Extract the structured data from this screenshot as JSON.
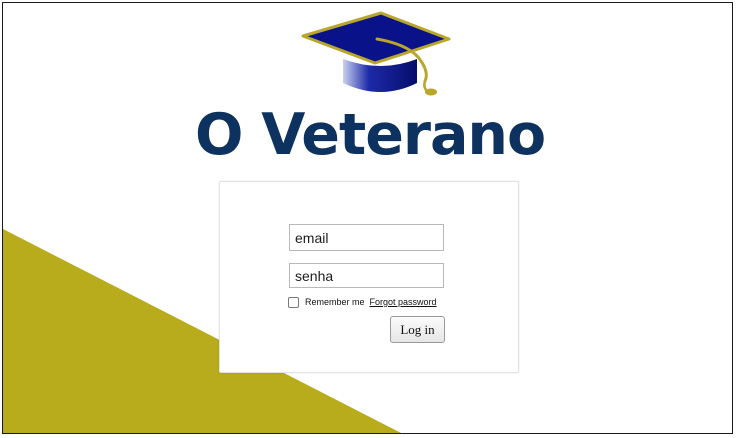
{
  "brand": {
    "name": "O Veterano",
    "logo_icon": "graduation-cap-icon",
    "text_color": "#0d3260",
    "cap_color": "#0a128a",
    "trim_color": "#b8a72a"
  },
  "background": {
    "wedge_color": "#b8ab1c"
  },
  "login": {
    "email_placeholder": "email",
    "password_placeholder": "senha",
    "remember_checked": false,
    "remember_label": "Remember me",
    "forgot_link": "Forgot password",
    "submit_label": "Log in"
  }
}
